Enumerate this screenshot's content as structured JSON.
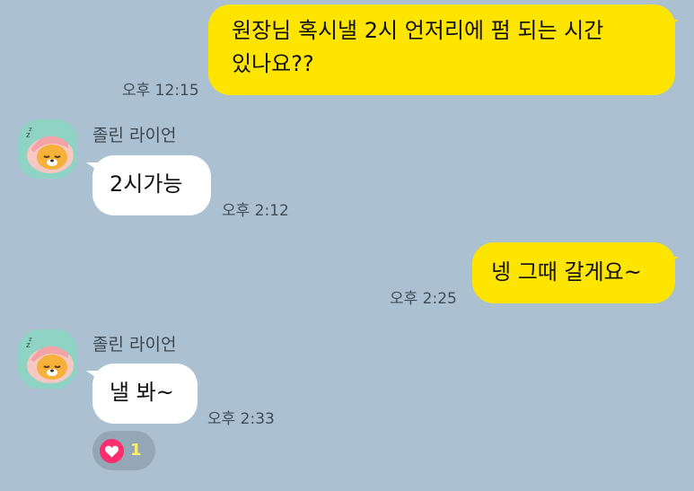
{
  "chat": {
    "messages": [
      {
        "side": "mine",
        "line1": "원장님 혹시낼 2시 언저리에 펌 되는 시간",
        "line2": "있나요??",
        "time": "오후 12:15"
      },
      {
        "side": "theirs",
        "sender": "졸린 라이언",
        "text": "2시가능",
        "time": "오후 2:12"
      },
      {
        "side": "mine",
        "text": "넹 그때 갈게요~",
        "time": "오후 2:25"
      },
      {
        "side": "theirs",
        "sender": "졸린 라이언",
        "text": "낼 봐~",
        "time": "오후 2:33",
        "reaction": {
          "icon": "heart-icon",
          "count": "1"
        }
      }
    ]
  },
  "colors": {
    "background": "#abc1d1",
    "my_bubble": "#fee500",
    "their_bubble": "#ffffff",
    "reaction_heart": "#ff2d6e"
  }
}
